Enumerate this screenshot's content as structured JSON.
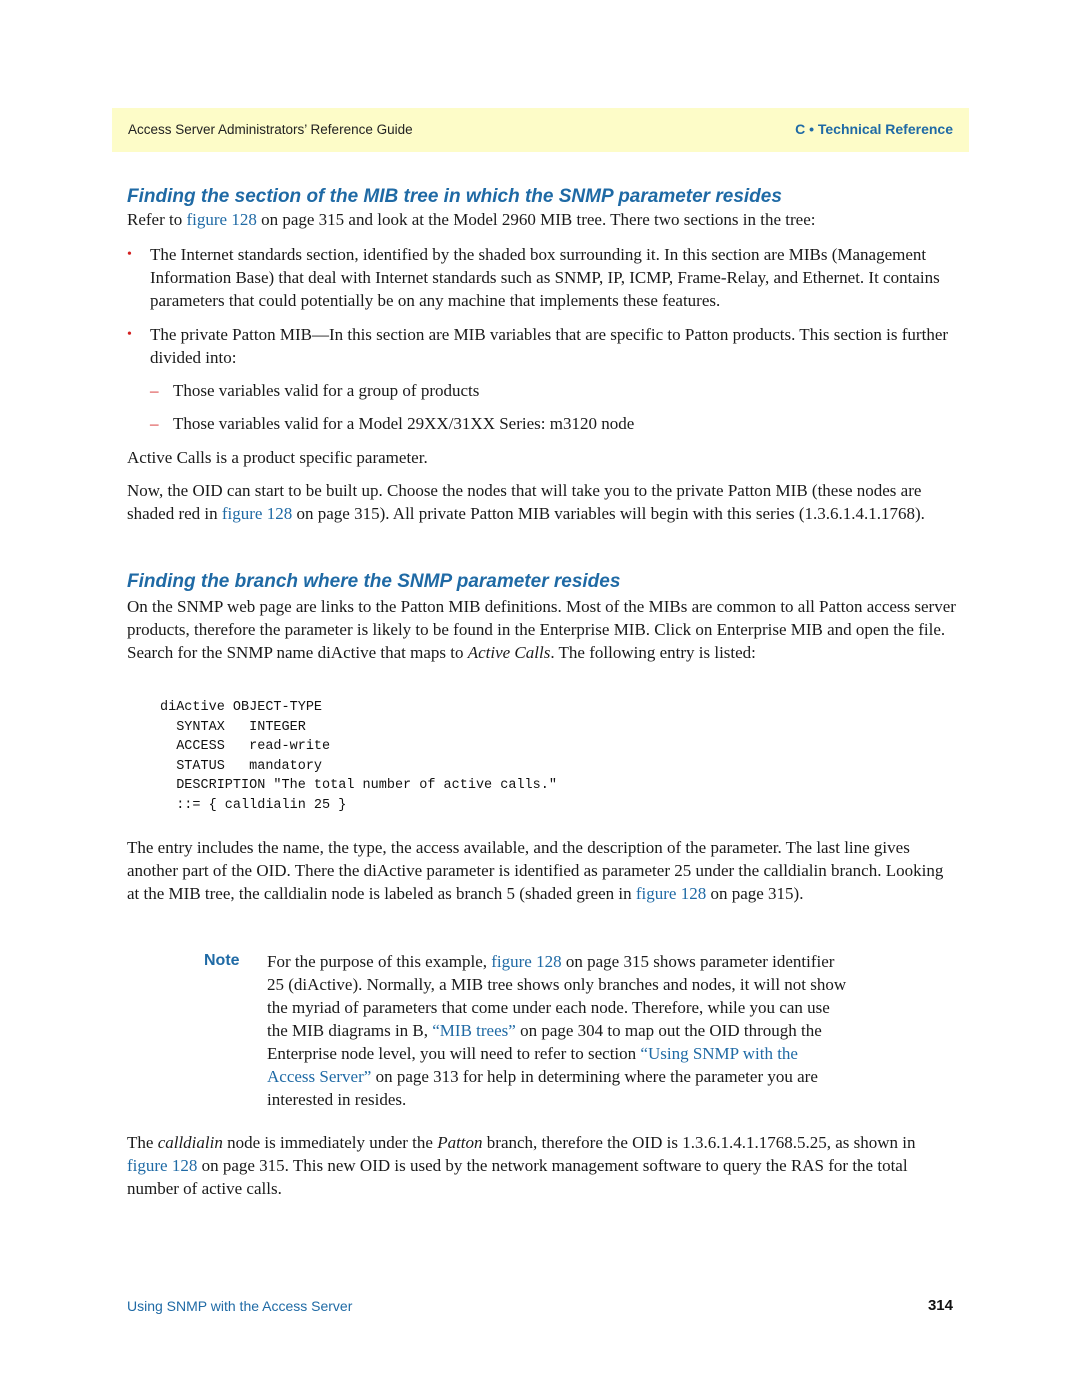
{
  "header": {
    "guide_title": "Access Server Administrators’ Reference Guide",
    "section": "C • Technical Reference"
  },
  "section1": {
    "heading": "Finding the section of the MIB tree in which the SNMP parameter resides",
    "intro_pre": "Refer to ",
    "intro_link": "figure 128",
    "intro_post": " on page 315 and look at the Model 2960 MIB tree. There two sections in the tree:",
    "bullets": [
      "The Internet standards section, identified by the shaded box surrounding it. In this section are MIBs (Management Information Base) that deal with Internet standards such as SNMP, IP, ICMP, Frame-Relay, and Ethernet. It contains parameters that could potentially be on any machine that implements these features.",
      "The private Patton MIB—In this section are MIB variables that are specific to Patton products. This section is further divided into:"
    ],
    "sub_items": [
      "Those variables valid for a group of products",
      "Those variables valid for a Model 29XX/31XX Series: m3120 node"
    ],
    "active_calls_text": "Active Calls is a product specific parameter.",
    "oid_pre": "Now, the OID can start to be built up. Choose the nodes that will take you to the private Patton MIB (these nodes are shaded red in ",
    "oid_link": "figure 128",
    "oid_post": " on page 315). All private Patton MIB variables will begin with this series (1.3.6.1.4.1.1768)."
  },
  "section2": {
    "heading": "Finding the branch where the SNMP parameter resides",
    "intro_pre": "On the SNMP web page are links to the Patton MIB definitions. Most of the MIBs are common to all Patton access server products, therefore the parameter is likely to be found in the Enterprise MIB. Click on Enterprise MIB and open the file. Search for the SNMP name diActive that maps to ",
    "intro_italic": "Active Calls",
    "intro_post": ". The following entry is listed:",
    "code_lines": [
      "diActive OBJECT-TYPE",
      "  SYNTAX   INTEGER",
      "  ACCESS   read-write",
      "  STATUS   mandatory",
      "  DESCRIPTION \"The total number of active calls.\"",
      "  ::= { calldialin 25 }"
    ],
    "entry_pre": "The entry includes the name, the type, the access available, and the description of the parameter. The last line gives another part of the OID. There the diActive parameter is identified as parameter 25 under the calldialin branch. Looking at the MIB tree, the calldialin node is labeled as branch 5 (shaded green in ",
    "entry_link": "figure 128",
    "entry_post": " on page 315).",
    "note_label": "Note",
    "note_1": "For the purpose of this example, ",
    "note_link1": "figure 128",
    "note_2": " on page 315 shows parameter identifier 25 (diActive). Normally, a MIB tree shows only branches and nodes, it will not show the myriad of parameters that come under each node. Therefore, while you can use the MIB diagrams in B, ",
    "note_link2": "“MIB trees”",
    "note_3": " on page 304 to map out the OID through the Enterprise node level, you will need to refer to section ",
    "note_link3": "“Using SNMP with the Access Server”",
    "note_4": " on page 313 for help in determining where the parameter you are interested in resides.",
    "final_1": "The ",
    "final_italic1": "calldialin",
    "final_2": " node is immediately under the ",
    "final_italic2": "Patton",
    "final_3": " branch, therefore the OID is 1.3.6.1.4.1.1768.5.25, as shown in ",
    "final_link": "figure 128",
    "final_4": " on page 315. This new OID is used by the network management software to query the RAS for the total number of active calls."
  },
  "footer": {
    "chapter": "Using SNMP with the Access Server",
    "page_number": "314"
  }
}
